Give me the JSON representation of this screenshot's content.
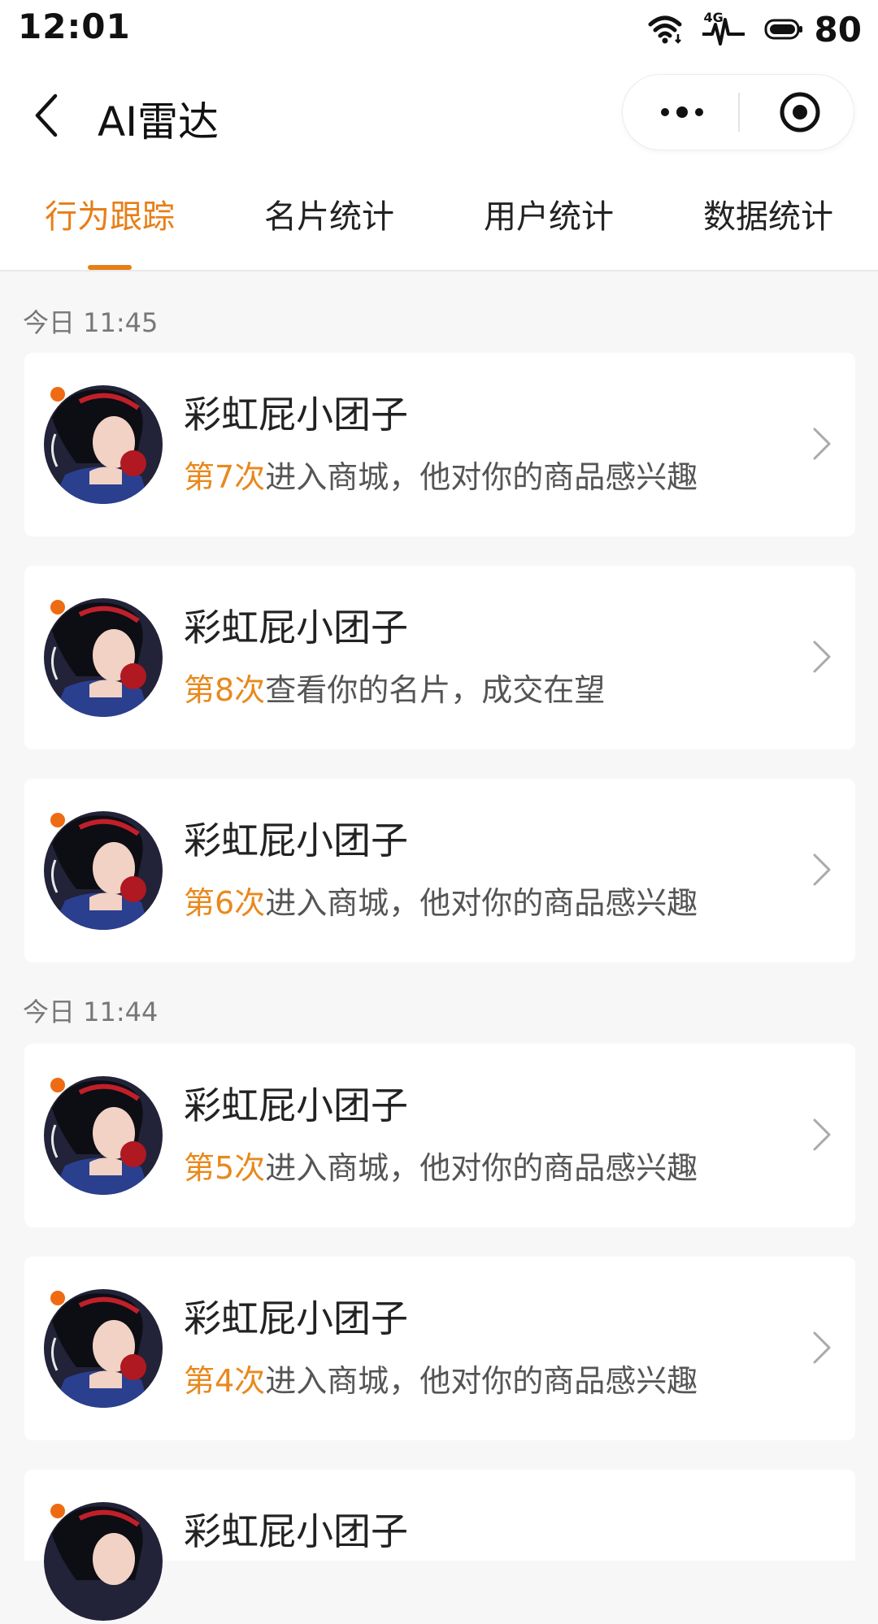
{
  "status_bar": {
    "time": "12:01",
    "network": "4G",
    "battery": "80",
    "icons": [
      "wifi-icon",
      "signal-4g-icon",
      "battery-icon"
    ]
  },
  "nav": {
    "title": "AI雷达",
    "back_icon": "back-icon",
    "more_icon": "more-icon",
    "close_icon": "close-miniprogram-icon"
  },
  "tabs": [
    {
      "label": "行为跟踪",
      "active": true
    },
    {
      "label": "名片统计",
      "active": false
    },
    {
      "label": "用户统计",
      "active": false
    },
    {
      "label": "数据统计",
      "active": false
    }
  ],
  "colors": {
    "accent": "#e87e16",
    "unread_dot": "#ef6b13",
    "page_bg": "#f7f7f7",
    "card_bg": "#ffffff"
  },
  "feed": [
    {
      "time_label": "今日 11:45",
      "items": [
        {
          "name": "彩虹屁小团子",
          "count": "第7次",
          "action": "进入商城，他对你的商品感兴趣"
        },
        {
          "name": "彩虹屁小团子",
          "count": "第8次",
          "action": "查看你的名片，成交在望"
        },
        {
          "name": "彩虹屁小团子",
          "count": "第6次",
          "action": "进入商城，他对你的商品感兴趣"
        }
      ]
    },
    {
      "time_label": "今日 11:44",
      "items": [
        {
          "name": "彩虹屁小团子",
          "count": "第5次",
          "action": "进入商城，他对你的商品感兴趣"
        },
        {
          "name": "彩虹屁小团子",
          "count": "第4次",
          "action": "进入商城，他对你的商品感兴趣"
        },
        {
          "name": "彩虹屁小团子",
          "count": "",
          "action": ""
        }
      ]
    }
  ]
}
